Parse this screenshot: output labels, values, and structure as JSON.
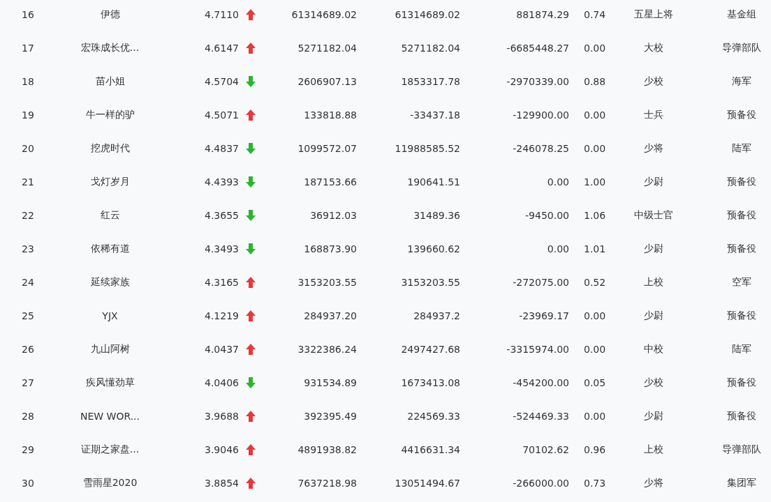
{
  "table": {
    "rows": [
      {
        "rank": "16",
        "name": "伊德",
        "score": "4.7110",
        "kind": "up",
        "column_4": "61314689.02",
        "column_5": "61314689.02",
        "column_6": "881874.29",
        "column_7": "0.74",
        "rank_title": "五星上将",
        "group": "基金组"
      },
      {
        "rank": "17",
        "name": "宏珠成长优...",
        "score": "4.6147",
        "kind": "up",
        "column_4": "5271182.04",
        "column_5": "5271182.04",
        "column_6": "-6685448.27",
        "column_7": "0.00",
        "rank_title": "大校",
        "group": "导弹部队"
      },
      {
        "rank": "18",
        "name": "苗小姐",
        "score": "4.5704",
        "kind": "down",
        "column_4": "2606907.13",
        "column_5": "1853317.78",
        "column_6": "-2970339.00",
        "column_7": "0.88",
        "rank_title": "少校",
        "group": "海军"
      },
      {
        "rank": "19",
        "name": "牛一样的驴",
        "score": "4.5071",
        "kind": "up",
        "column_4": "133818.88",
        "column_5": "-33437.18",
        "column_6": "-129900.00",
        "column_7": "0.00",
        "rank_title": "士兵",
        "group": "预备役"
      },
      {
        "rank": "20",
        "name": "挖虎时代",
        "score": "4.4837",
        "kind": "down",
        "column_4": "1099572.07",
        "column_5": "11988585.52",
        "column_6": "-246078.25",
        "column_7": "0.00",
        "rank_title": "少将",
        "group": "陆军"
      },
      {
        "rank": "21",
        "name": "戈灯岁月",
        "score": "4.4393",
        "kind": "down",
        "column_4": "187153.66",
        "column_5": "190641.51",
        "column_6": "0.00",
        "column_7": "1.00",
        "rank_title": "少尉",
        "group": "预备役"
      },
      {
        "rank": "22",
        "name": "红云",
        "score": "4.3655",
        "kind": "down",
        "column_4": "36912.03",
        "column_5": "31489.36",
        "column_6": "-9450.00",
        "column_7": "1.06",
        "rank_title": "中级士官",
        "group": "预备役"
      },
      {
        "rank": "23",
        "name": "依稀有道",
        "score": "4.3493",
        "kind": "down",
        "column_4": "168873.90",
        "column_5": "139660.62",
        "column_6": "0.00",
        "column_7": "1.01",
        "rank_title": "少尉",
        "group": "预备役"
      },
      {
        "rank": "24",
        "name": "延续家族",
        "score": "4.3165",
        "kind": "up",
        "column_4": "3153203.55",
        "column_5": "3153203.55",
        "column_6": "-272075.00",
        "column_7": "0.52",
        "rank_title": "上校",
        "group": "空军"
      },
      {
        "rank": "25",
        "name": "YJX",
        "score": "4.1219",
        "kind": "up",
        "column_4": "284937.20",
        "column_5": "284937.2",
        "column_6": "-23969.17",
        "column_7": "0.00",
        "rank_title": "少尉",
        "group": "预备役"
      },
      {
        "rank": "26",
        "name": "九山阿树",
        "score": "4.0437",
        "kind": "up",
        "column_4": "3322386.24",
        "column_5": "2497427.68",
        "column_6": "-3315974.00",
        "column_7": "0.00",
        "rank_title": "中校",
        "group": "陆军"
      },
      {
        "rank": "27",
        "name": "疾风懂劲草",
        "score": "4.0406",
        "kind": "down",
        "column_4": "931534.89",
        "column_5": "1673413.08",
        "column_6": "-454200.00",
        "column_7": "0.05",
        "rank_title": "少校",
        "group": "预备役"
      },
      {
        "rank": "28",
        "name": "NEW WOR...",
        "score": "3.9688",
        "kind": "up",
        "column_4": "392395.49",
        "column_5": "224569.33",
        "column_6": "-524469.33",
        "column_7": "0.00",
        "rank_title": "少尉",
        "group": "预备役"
      },
      {
        "rank": "29",
        "name": "证期之家盘...",
        "score": "3.9046",
        "kind": "up",
        "column_4": "4891938.82",
        "column_5": "4416631.34",
        "column_6": "70102.62",
        "column_7": "0.96",
        "rank_title": "上校",
        "group": "导弹部队"
      },
      {
        "rank": "30",
        "name": "雪雨星2020",
        "score": "3.8854",
        "kind": "up",
        "column_4": "7637218.98",
        "column_5": "13051494.67",
        "column_6": "-266000.00",
        "column_7": "0.73",
        "rank_title": "少将",
        "group": "集团军"
      }
    ]
  }
}
